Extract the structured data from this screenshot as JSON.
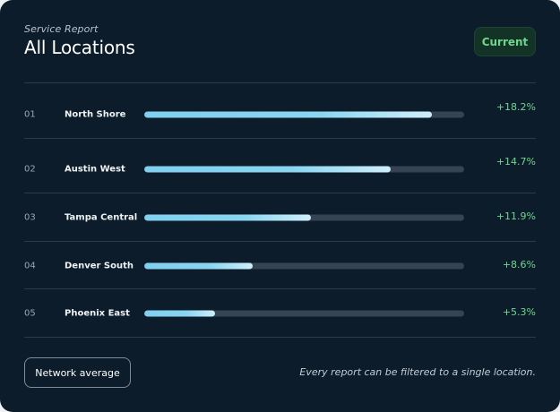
{
  "header": {
    "subtitle": "Service Report",
    "title": "All Locations",
    "current_label": "Current"
  },
  "rows": [
    {
      "index": "01",
      "name": "North Shore",
      "progress": 0.9,
      "delta": "+18.2%"
    },
    {
      "index": "02",
      "name": "Austin West",
      "progress": 0.77,
      "delta": "+14.7%"
    },
    {
      "index": "03",
      "name": "Tampa Central",
      "progress": 0.52,
      "delta": "+11.9%"
    },
    {
      "index": "04",
      "name": "Denver South",
      "progress": 0.34,
      "delta": "+8.6%"
    },
    {
      "index": "05",
      "name": "Phoenix East",
      "progress": 0.22,
      "delta": "+5.3%"
    }
  ],
  "footer": {
    "button_label": "Network average",
    "note": "Every report can be filtered to a single location."
  },
  "colors": {
    "background": "#0c1c2a",
    "accent_green": "#6fd78d",
    "bar_track": "#354352",
    "bar_fill": "#7fd0ef"
  }
}
